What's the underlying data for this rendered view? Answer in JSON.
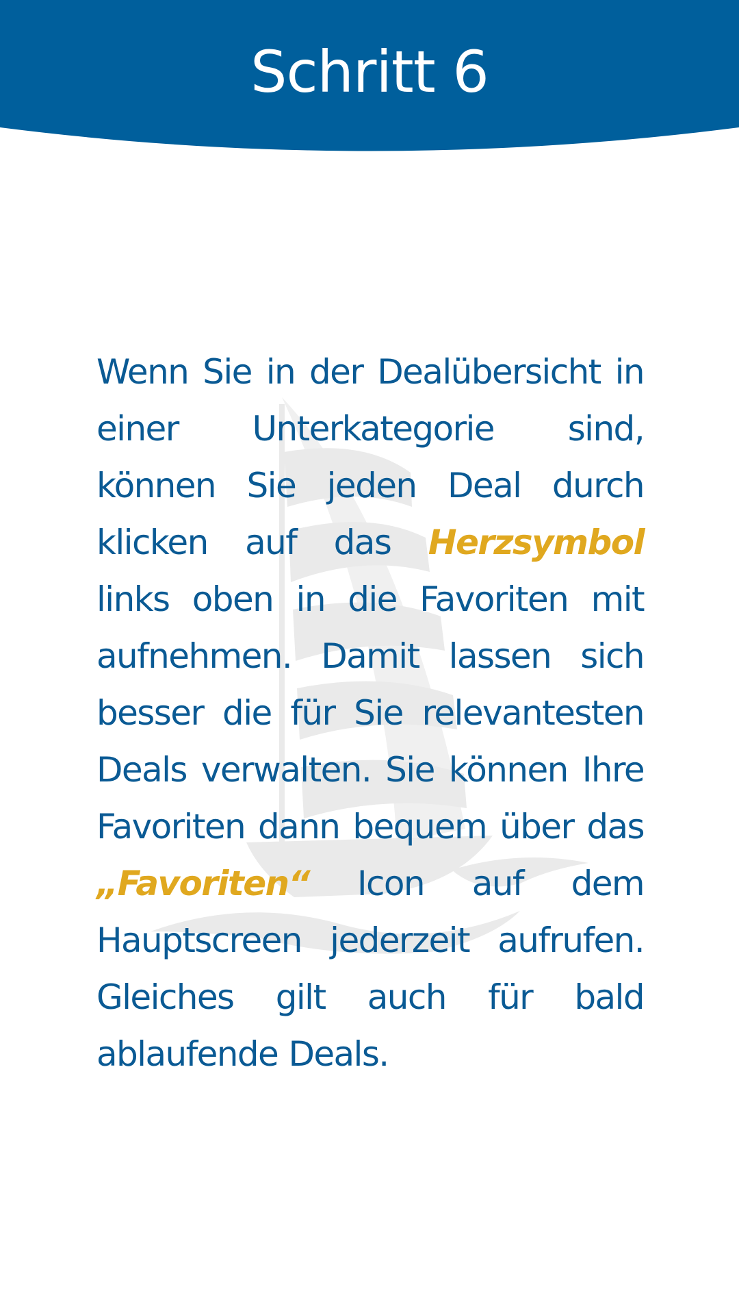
{
  "header": {
    "title": "Schritt 6",
    "background_color": "#005f9c",
    "title_color": "#ffffff"
  },
  "watermark": {
    "icon": "sailboat-watermark-icon",
    "color": "#e8e8e8"
  },
  "body": {
    "text_color": "#0a5a94",
    "highlight_color": "#e0a81f",
    "part1": "Wenn Sie in der Dealübersicht in einer Unterkategorie sind, können Sie jeden Deal durch klicken auf das ",
    "highlight1": "Herzsymbol",
    "part2": " links oben in die Favoriten mit aufnehmen. Damit lassen sich besser die für Sie rele­vantesten Deals verwalten. Sie können Ihre Favoriten dann bequem über das ",
    "highlight2": "„Favoriten“",
    "part3": " Icon auf dem Hauptscreen jeder­zeit aufrufen. Gleiches gilt auch für bald ablaufende Deals."
  }
}
